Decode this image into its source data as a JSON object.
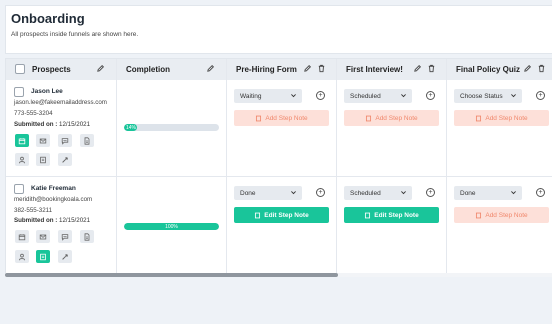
{
  "page": {
    "title": "Onboarding",
    "subtitle": "All prospects inside funnels are shown here."
  },
  "columns": {
    "prospects": "Prospects",
    "completion": "Completion",
    "step1": "Pre-Hiring Form",
    "step2": "First Interview!",
    "step3": "Final Policy Quiz"
  },
  "rows": [
    {
      "name": "Jason Lee",
      "email": "jason.lee@fakeemailaddress.com",
      "phone": "773-555-3204",
      "submitted_label": "Submitted on :",
      "submitted_date": "12/15/2021",
      "progress_label": "14%",
      "progress": 14,
      "step1_status": "Waiting",
      "step1_note": "Add Step Note",
      "step2_status": "Scheduled",
      "step2_note": "Add Step Note",
      "step3_status": "Choose Status",
      "step3_note": "Add Step Note"
    },
    {
      "name": "Katie Freeman",
      "email": "meridith@bookingkoala.com",
      "phone": "382-555-3211",
      "submitted_label": "Submitted on :",
      "submitted_date": "12/15/2021",
      "progress_label": "100%",
      "progress": 100,
      "step1_status": "Done",
      "step1_note": "Edit Step Note",
      "step2_status": "Scheduled",
      "step2_note": "Edit Step Note",
      "step3_status": "Done",
      "step3_note": "Add Step Note"
    }
  ],
  "colors": {
    "accent": "#19c59a",
    "add_note_bg": "#fde0d9",
    "add_note_text": "#f0876c"
  },
  "icons": [
    "pencil-icon",
    "trash-icon",
    "calendar-icon",
    "mail-icon",
    "chat-icon",
    "document-icon",
    "person-icon",
    "note-icon",
    "tools-icon",
    "chevron-down-icon",
    "plus-icon"
  ]
}
